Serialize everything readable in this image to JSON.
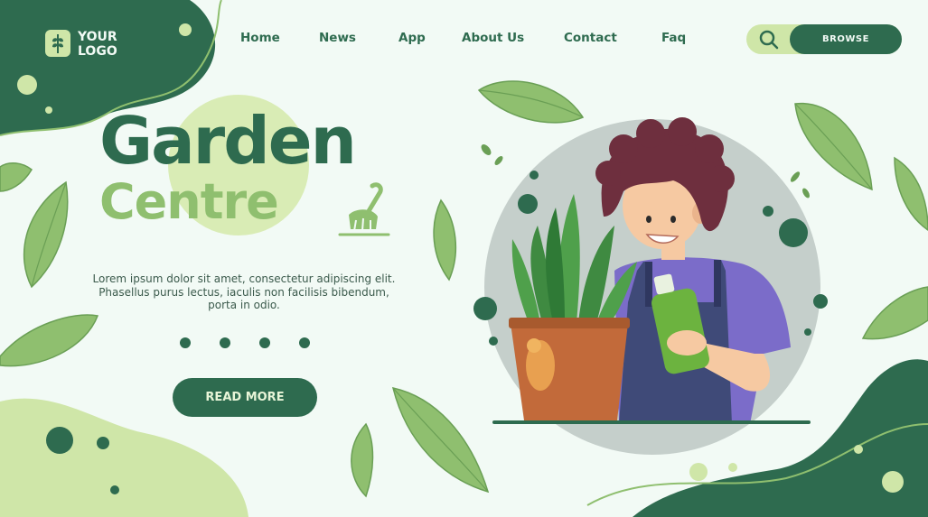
{
  "logo": {
    "line1": "YOUR",
    "line2": "LOGO",
    "icon": "wheat-leaf-icon"
  },
  "nav": {
    "items": [
      {
        "label": "Home"
      },
      {
        "label": "News"
      },
      {
        "label": "App"
      },
      {
        "label": "About Us"
      },
      {
        "label": "Contact"
      },
      {
        "label": "Faq"
      }
    ],
    "search_icon": "search-icon",
    "browse_label": "BROWSE"
  },
  "hero": {
    "title_line1": "Garden",
    "title_line2": "Centre",
    "description": "Lorem ipsum dolor sit amet, consectetur adipiscing elit. Phasellus purus lectus, iaculis non facilisis bibendum, porta in odio.",
    "read_more_label": "READ MORE",
    "slider_dots": 4
  },
  "colors": {
    "background": "#f2faf5",
    "primary": "#2e6b4f",
    "accent": "#8fbf6f",
    "light_accent": "#cfe6a8"
  }
}
